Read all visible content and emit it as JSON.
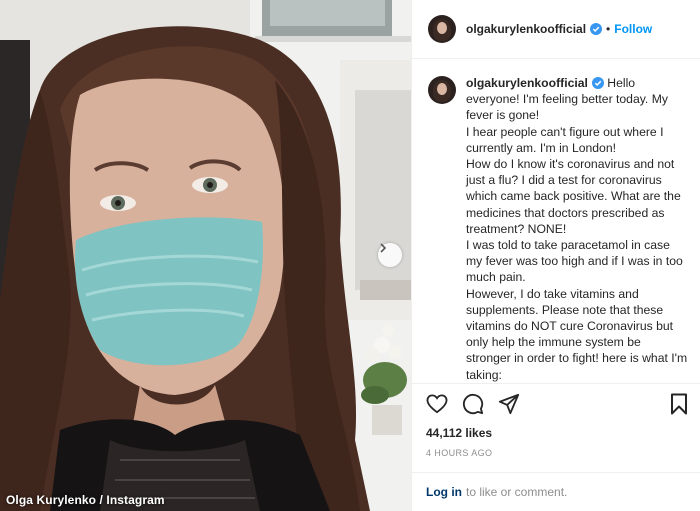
{
  "photo": {
    "credit": "Olga Kurylenko / Instagram"
  },
  "header": {
    "username": "olgakurylenkoofficial",
    "separator": "•",
    "follow_label": "Follow"
  },
  "caption": {
    "username": "olgakurylenkoofficial",
    "text": " Hello everyone! I'm feeling better today. My fever is gone!\nI hear people can't figure out where I currently am. I'm in London!\nHow do I know it's coronavirus and not just a flu? I did a test for coronavirus which came back positive. What are the medicines that doctors prescribed as treatment? NONE!\nI was told to take paracetamol in case my fever was too high and if I was in too much pain.\nHowever, I do take vitamins and supplements. Please note that these vitamins do NOT cure Coronavirus but only help the immune system be stronger in order to fight! here is what I'm taking:"
  },
  "stats": {
    "likes": "44,112 likes",
    "timestamp": "4 HOURS AGO"
  },
  "login": {
    "link": "Log in",
    "text": "to like or comment."
  },
  "icons": {
    "like": "heart-icon",
    "comment": "comment-icon",
    "share": "share-icon",
    "save": "bookmark-icon",
    "verified": "verified-badge-icon",
    "carousel": "chevron-right-icon"
  },
  "colors": {
    "link_blue": "#0095f6",
    "verified_blue": "#3897f0",
    "text": "#262626",
    "muted": "#8e8e8e"
  }
}
